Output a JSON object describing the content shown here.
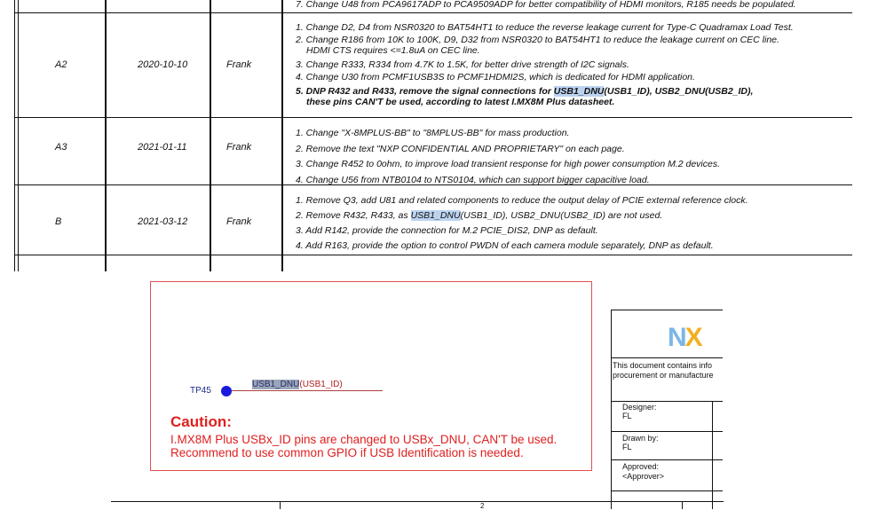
{
  "top_note": "7. Change U48 from PCA9617ADP to PCA9509ADP for better compatibility of HDMI monitors, R185 needs be populated.",
  "revisions": [
    {
      "rev": "A2",
      "date": "2020-10-10",
      "author": "Frank",
      "notes": [
        "1. Change D2, D4 from NSR0320 to BAT54HT1 to reduce the reverse leakage current for Type-C Quadramax Load Test.",
        "2. Change R186 from 10K to 100K, D9, D32 from NSR0320 to BAT54HT1 to reduce the leakage current on CEC line.",
        "HDMI CTS requires <=1.8uA on CEC line.",
        "3. Change R333, R334 from 4.7K to 1.5K, for better drive strength of I2C signals.",
        "4. Change U30 from PCMF1USB3S to PCMF1HDMI2S, which is dedicated for HDMI application."
      ],
      "bold_note_prefix": "5. DNP R432 and R433, remove the signal connections for ",
      "bold_note_highlight": "USB1_DNU",
      "bold_note_suffix": "(USB1_ID), USB2_DNU(USB2_ID),",
      "bold_note_line2": "these pins CAN'T be used, according to latest I.MX8M Plus datasheet."
    },
    {
      "rev": "A3",
      "date": "2021-01-11",
      "author": "Frank",
      "notes": [
        "1. Change \"X-8MPLUS-BB\" to \"8MPLUS-BB\" for mass production.",
        "2. Remove the text \"NXP CONFIDENTIAL AND PROPRIETARY\" on each page.",
        "3. Change R452 to 0ohm, to improve load transient response for high power consumption M.2 devices.",
        "4. Change U56 from NTB0104 to NTS0104, which can support bigger capacitive load."
      ]
    },
    {
      "rev": "B",
      "date": "2021-03-12",
      "author": "Frank",
      "note1": "1. Remove Q3, add U81 and related components to reduce the output delay of PCIE external reference clock.",
      "note2_prefix": "2. Remove R432, R433, as ",
      "note2_highlight": "USB1_DNU",
      "note2_suffix": "(USB1_ID), USB2_DNU(USB2_ID) are not used.",
      "note3": "3. Add R142, provide the connection for M.2 PCIE_DIS2, DNP as default.",
      "note4": "4. Add R163, provide the option to control PWDN of each camera module separately, DNP as default."
    }
  ],
  "schematic": {
    "testpoint": "TP45",
    "net_highlight": "USB1_DNU",
    "net_suffix": "(USB1_ID)",
    "caution_title": "Caution:",
    "caution_line1": "I.MX8M Plus USBx_ID pins are changed to USBx_DNU, CAN'T be used.",
    "caution_line2": "Recommend to use common GPIO if USB Identification is needed."
  },
  "title_block": {
    "logo": "NX",
    "info_line1": "This document contains info",
    "info_line2": "procurement or manufacture",
    "designer_label": "Designer:",
    "designer_value": "FL",
    "drawn_label": "Drawn by:",
    "drawn_value": "FL",
    "approved_label": "Approved:",
    "approved_value": "<Approver>"
  },
  "page_number": "2",
  "colors": {
    "caution": "#e02020",
    "highlight": "#bcd3f0",
    "logo_n": "#7ab7e6",
    "logo_x": "#f0b020"
  }
}
